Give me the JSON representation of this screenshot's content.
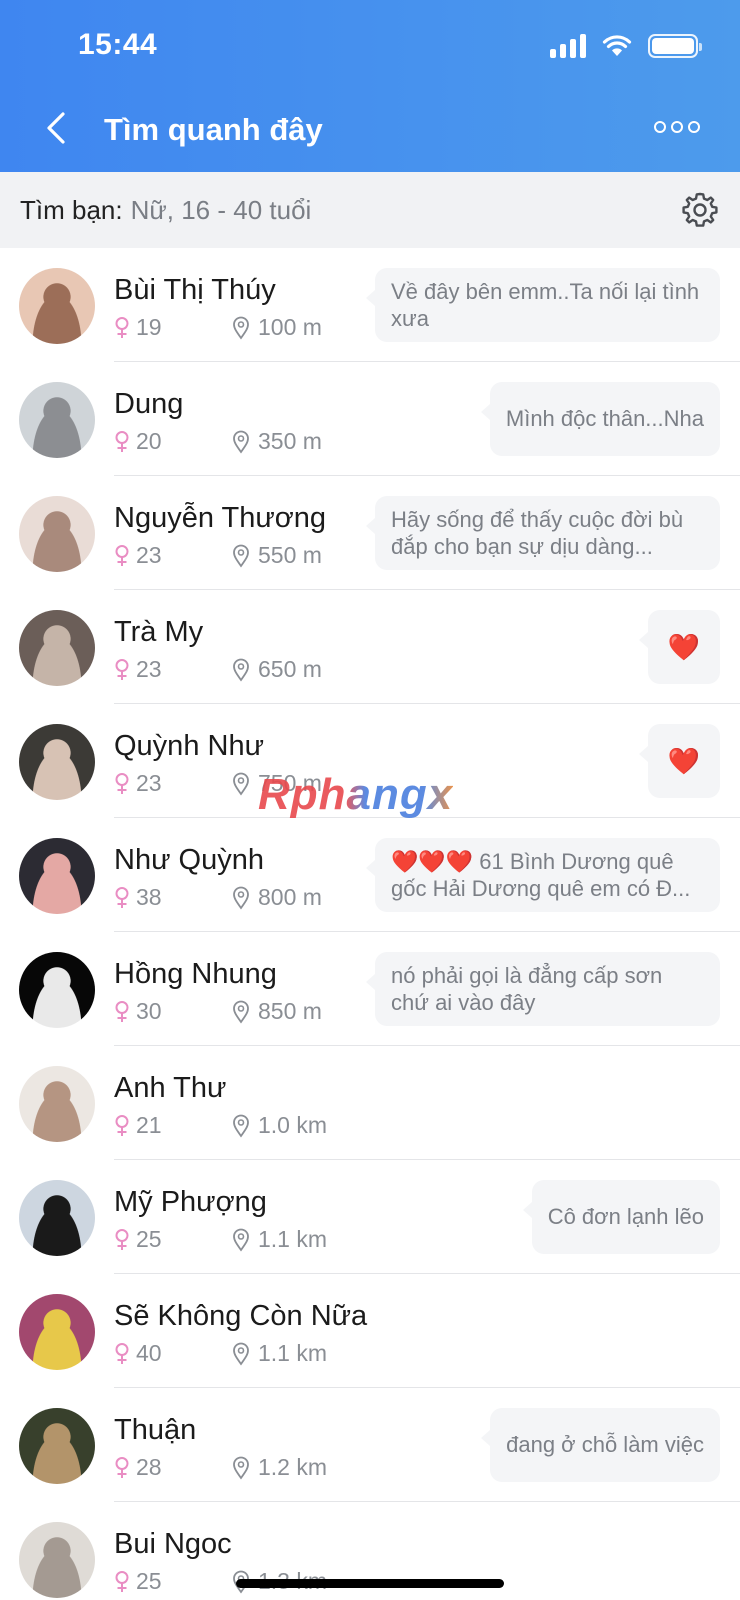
{
  "status_bar": {
    "time": "15:44"
  },
  "header": {
    "title": "Tìm quanh đây"
  },
  "filter": {
    "label": "Tìm bạn:",
    "value": "Nữ, 16 - 40 tuổi"
  },
  "colors": {
    "header_start": "#3f86f0",
    "header_end": "#4d9bec",
    "female_icon": "#e98dc3",
    "heart": "#e0262b"
  },
  "users": [
    {
      "name": "Bùi Thị Thúy",
      "age": "19",
      "distance": "100 m",
      "status": "Về đây bên emm..Ta nối lại tình xưa",
      "avatar_colors": [
        "#e8c7b4",
        "#9c6e58"
      ]
    },
    {
      "name": "Dung",
      "age": "20",
      "distance": "350 m",
      "status": "Mình độc thân...Nha",
      "avatar_colors": [
        "#cfd4d8",
        "#8c8e92"
      ]
    },
    {
      "name": "Nguyễn Thương",
      "age": "23",
      "distance": "550 m",
      "status": "Hãy sống để thấy cuộc đời bù đắp cho bạn sự dịu dàng...",
      "avatar_colors": [
        "#e9dcd6",
        "#a98a7c"
      ]
    },
    {
      "name": "Trà My",
      "age": "23",
      "distance": "650 m",
      "status": "❤️",
      "avatar_colors": [
        "#6b5e58",
        "#c5b4a8"
      ]
    },
    {
      "name": "Quỳnh Như",
      "age": "23",
      "distance": "750 m",
      "status": "❤️",
      "avatar_colors": [
        "#3c3a36",
        "#d7c2b4"
      ]
    },
    {
      "name": "Như Quỳnh",
      "age": "38",
      "distance": "800 m",
      "status": "❤️❤️❤️ 61 Bình Dương quê gốc Hải Dương quê em có Đ...",
      "avatar_colors": [
        "#2c2b33",
        "#e4a8a4"
      ]
    },
    {
      "name": "Hồng Nhung",
      "age": "30",
      "distance": "850 m",
      "status": "nó phải gọi là đẳng cấp sơn chứ ai vào đây",
      "avatar_colors": [
        "#070707",
        "#e9e9e9"
      ]
    },
    {
      "name": "Anh Thư",
      "age": "21",
      "distance": "1.0 km",
      "status": "",
      "avatar_colors": [
        "#ece7e2",
        "#b59582"
      ]
    },
    {
      "name": "Mỹ Phượng",
      "age": "25",
      "distance": "1.1 km",
      "status": "Cô đơn lạnh lẽo",
      "avatar_colors": [
        "#cdd6e0",
        "#1a1a1a"
      ]
    },
    {
      "name": "Sẽ Không Còn Nữa",
      "age": "40",
      "distance": "1.1 km",
      "status": "",
      "avatar_colors": [
        "#a2486e",
        "#e7c84a"
      ]
    },
    {
      "name": "Thuận",
      "age": "28",
      "distance": "1.2 km",
      "status": "đang ở chỗ làm việc",
      "avatar_colors": [
        "#38402c",
        "#b3946a"
      ]
    },
    {
      "name": "Bui Ngoc",
      "age": "25",
      "distance": "1.3 km",
      "status": "",
      "avatar_colors": [
        "#dfdbd6",
        "#a49a92"
      ]
    }
  ],
  "watermark": "Rphangx"
}
